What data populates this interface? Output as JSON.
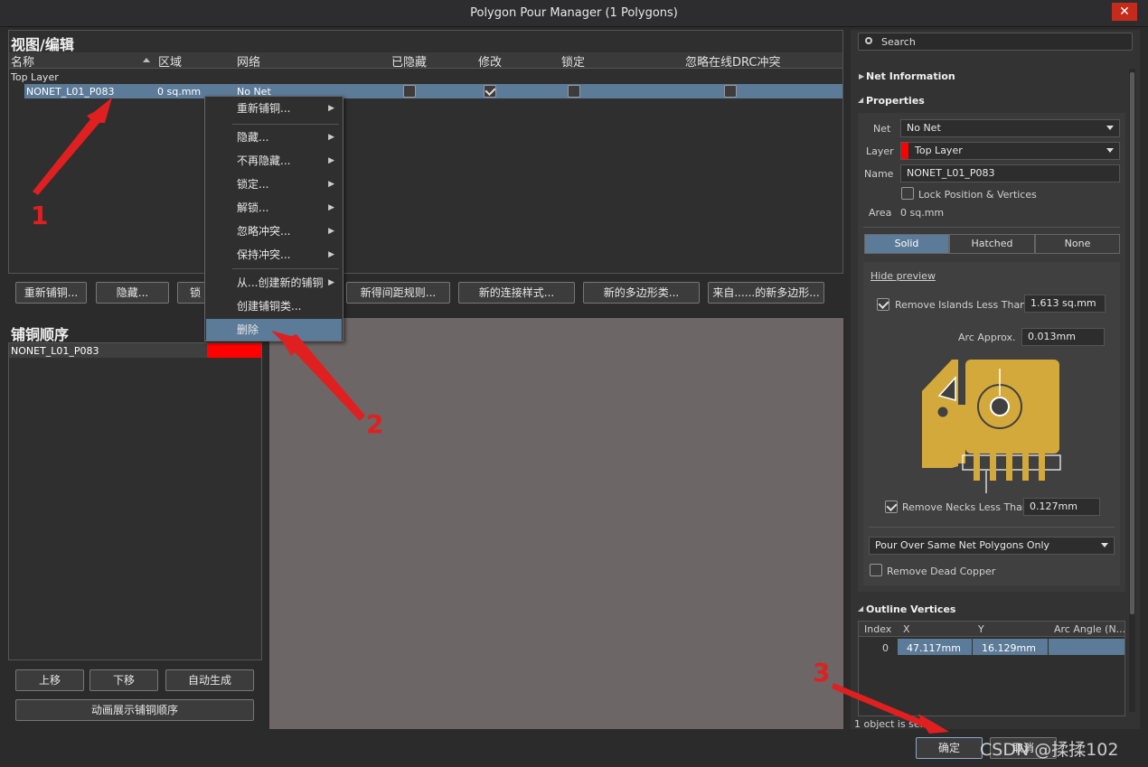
{
  "window": {
    "title": "Polygon Pour Manager (1 Polygons)",
    "close_glyph": "✕"
  },
  "view_edit": {
    "title": "视图/编辑",
    "columns": [
      "名称",
      "区域",
      "网络",
      "已隐藏",
      "修改",
      "锁定",
      "忽略在线DRC冲突"
    ],
    "group": "Top Layer",
    "row": {
      "name": "NONET_L01_P083",
      "area": "0 sq.mm",
      "net": "No Net"
    }
  },
  "context_menu": {
    "items": [
      "重新铺铜...",
      "隐藏...",
      "不再隐藏...",
      "锁定...",
      "解锁...",
      "忽略冲突...",
      "保持冲突...",
      "从...创建新的铺铜",
      "创建铺铜类...",
      "删除"
    ]
  },
  "action_buttons": [
    "重新铺铜...",
    "隐藏...",
    "锁",
    "新得间距规则...",
    "新的连接样式...",
    "新的多边形类...",
    "来自......的新多边形..."
  ],
  "pour_order": {
    "title": "铺铜顺序",
    "row": "NONET_L01_P083",
    "row_color": "#ff0000",
    "buttons": {
      "up": "上移",
      "down": "下移",
      "auto": "自动生成",
      "animate": "动画展示铺铜顺序"
    }
  },
  "right_panel": {
    "search_placeholder": "Search",
    "net_info": "Net Information",
    "properties": "Properties",
    "net_label": "Net",
    "net_value": "No Net",
    "layer_label": "Layer",
    "layer_value": "Top Layer",
    "layer_color": "#ff0000",
    "name_label": "Name",
    "name_value": "NONET_L01_P083",
    "lock_label": "Lock Position & Vertices",
    "area_label": "Area",
    "area_value": "0 sq.mm",
    "fill_modes": [
      "Solid",
      "Hatched",
      "None"
    ],
    "hide_preview": "Hide preview",
    "remove_islands_label": "Remove Islands Less Than",
    "remove_islands_value": "1.613 sq.mm",
    "arc_label": "Arc Approx.",
    "arc_value": "0.013mm",
    "remove_necks_label": "Remove Necks Less Than",
    "remove_necks_value": "0.127mm",
    "pour_over": "Pour Over Same Net Polygons Only",
    "remove_dead": "Remove Dead Copper",
    "outline": "Outline Vertices",
    "vertex_cols": [
      "Index",
      "X",
      "Y",
      "Arc Angle (N..."
    ],
    "vertex_row": {
      "index": "0",
      "x": "47.117mm",
      "y": "16.129mm"
    },
    "status": "1 object is sele..."
  },
  "footer": {
    "ok": "确定",
    "cancel": "取消",
    "watermark": "CSDN @揉揉102"
  },
  "annotations": [
    "1",
    "2",
    "3"
  ],
  "colors": {
    "accent": "#5c7b99",
    "copper": "#d4a93c",
    "annotation": "#e02020"
  }
}
